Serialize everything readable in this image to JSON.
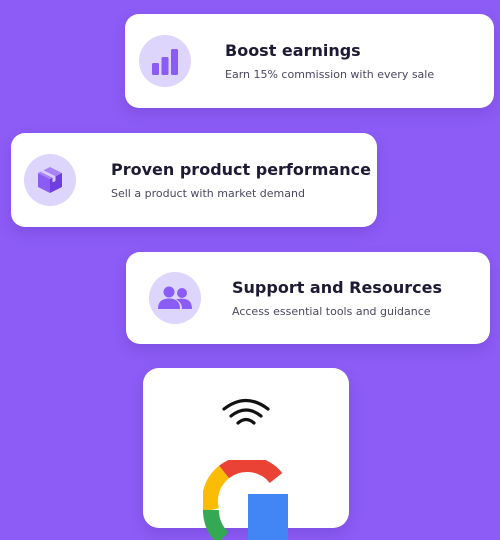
{
  "cards": [
    {
      "title": "Boost earnings",
      "description": "Earn 15% commission with every sale",
      "icon": "bar-chart-icon"
    },
    {
      "title": "Proven product performance",
      "description": "Sell a product with market demand",
      "icon": "box-icon"
    },
    {
      "title": "Support and Resources",
      "description": "Access essential tools and guidance",
      "icon": "users-icon"
    }
  ],
  "bottom_card": {
    "icons": [
      "wifi-icon",
      "google-logo-icon"
    ]
  },
  "colors": {
    "background": "#8d5cf6",
    "icon_circle": "#ddd5fb",
    "icon_fill": "#8a5cf5",
    "card": "#ffffff",
    "title_text": "#1d1a33",
    "desc_text": "#4a4760"
  }
}
